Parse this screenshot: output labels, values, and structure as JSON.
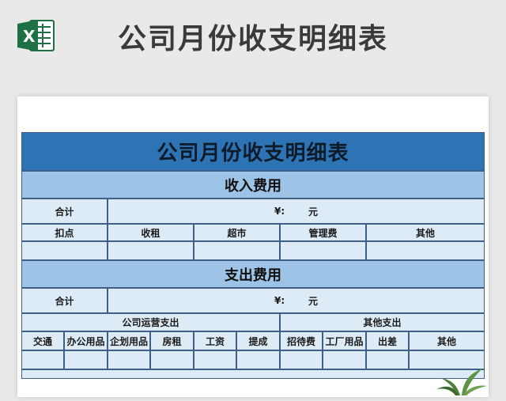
{
  "header": {
    "title": "公司月份收支明细表",
    "logo_letter": "X"
  },
  "sheet": {
    "title": "公司月份收支明细表",
    "income": {
      "section_title": "收入费用",
      "total_label": "合计",
      "currency": "¥:",
      "unit": "元",
      "columns": [
        "扣点",
        "收租",
        "超市",
        "管理费",
        "其他"
      ]
    },
    "expense": {
      "section_title": "支出费用",
      "total_label": "合计",
      "currency": "¥:",
      "unit": "元",
      "group_company": "公司运营支出",
      "group_other": "其他支出",
      "columns": [
        "交通",
        "办公用品",
        "企划用品",
        "房租",
        "工资",
        "提成",
        "招待费",
        "工厂用品",
        "出差",
        "其他"
      ]
    }
  },
  "colors": {
    "title_bar": "#2e74b5",
    "section_bar": "#9dc3e6",
    "cell_fill": "#ddebf7",
    "border": "#3f5f86"
  }
}
